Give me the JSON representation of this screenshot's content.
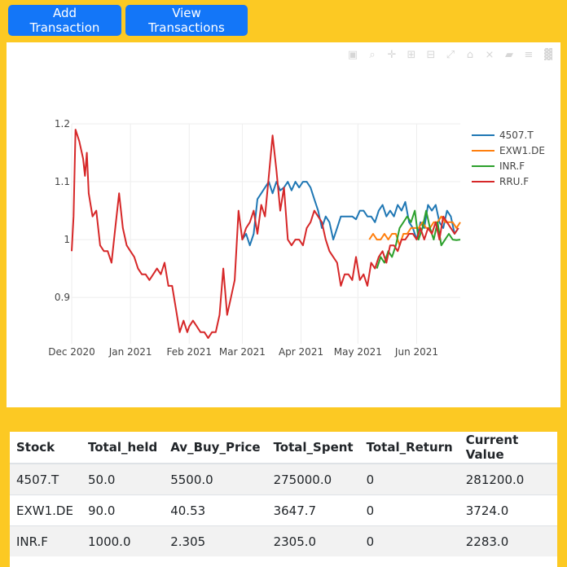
{
  "buttons": {
    "add": "Add Transaction",
    "view": "View Transactions"
  },
  "modebar": [
    "camera-icon",
    "zoom-icon",
    "pan-icon",
    "zoom-in-icon",
    "zoom-out-icon",
    "autoscale-icon",
    "reset-axes-icon",
    "spike-lines-icon",
    "hover-closest-icon",
    "hover-compare-icon",
    "plotly-logo-icon"
  ],
  "chart_data": {
    "type": "line",
    "x_tick_labels": [
      "Dec 2020",
      "Jan 2021",
      "Feb 2021",
      "Mar 2021",
      "Apr 2021",
      "May 2021",
      "Jun 2021"
    ],
    "x_tick_dates": [
      "2020-12-01",
      "2021-01-01",
      "2021-02-01",
      "2021-03-01",
      "2021-04-01",
      "2021-05-01",
      "2021-06-01"
    ],
    "xlim": [
      "2020-12-01",
      "2021-06-24"
    ],
    "y_tick_labels": [
      "0.9",
      "1",
      "1.1",
      "1.2"
    ],
    "y_tick_values": [
      0.9,
      1.0,
      1.1,
      1.2
    ],
    "ylim": [
      0.82,
      1.2
    ],
    "grid": true,
    "legend": "top-right",
    "series": [
      {
        "name": "4507.T",
        "color": "#1f77b4",
        "x": [
          "2021-03-01",
          "2021-03-03",
          "2021-03-05",
          "2021-03-07",
          "2021-03-09",
          "2021-03-11",
          "2021-03-13",
          "2021-03-15",
          "2021-03-17",
          "2021-03-19",
          "2021-03-21",
          "2021-03-23",
          "2021-03-25",
          "2021-03-27",
          "2021-03-29",
          "2021-03-31",
          "2021-04-02",
          "2021-04-04",
          "2021-04-06",
          "2021-04-08",
          "2021-04-10",
          "2021-04-12",
          "2021-04-14",
          "2021-04-16",
          "2021-04-18",
          "2021-04-20",
          "2021-04-22",
          "2021-04-24",
          "2021-04-26",
          "2021-04-28",
          "2021-04-30",
          "2021-05-02",
          "2021-05-04",
          "2021-05-06",
          "2021-05-08",
          "2021-05-10",
          "2021-05-12",
          "2021-05-14",
          "2021-05-16",
          "2021-05-18",
          "2021-05-20",
          "2021-05-22",
          "2021-05-24",
          "2021-05-26",
          "2021-05-28",
          "2021-05-30",
          "2021-06-01",
          "2021-06-03",
          "2021-06-05",
          "2021-06-07",
          "2021-06-09",
          "2021-06-11",
          "2021-06-13",
          "2021-06-15",
          "2021-06-17",
          "2021-06-19",
          "2021-06-21",
          "2021-06-23"
        ],
        "y": [
          1.0,
          1.01,
          0.99,
          1.01,
          1.07,
          1.08,
          1.09,
          1.1,
          1.08,
          1.1,
          1.085,
          1.09,
          1.1,
          1.085,
          1.1,
          1.09,
          1.1,
          1.1,
          1.09,
          1.07,
          1.05,
          1.02,
          1.04,
          1.03,
          1.0,
          1.02,
          1.04,
          1.04,
          1.04,
          1.04,
          1.035,
          1.05,
          1.05,
          1.04,
          1.04,
          1.03,
          1.05,
          1.06,
          1.04,
          1.05,
          1.04,
          1.06,
          1.05,
          1.065,
          1.03,
          1.02,
          1.0,
          1.03,
          1.02,
          1.06,
          1.05,
          1.06,
          1.03,
          1.02,
          1.05,
          1.04,
          1.01,
          1.02
        ]
      },
      {
        "name": "EXW1.DE",
        "color": "#ff7f0e",
        "x": [
          "2021-05-07",
          "2021-05-09",
          "2021-05-11",
          "2021-05-13",
          "2021-05-15",
          "2021-05-17",
          "2021-05-19",
          "2021-05-21",
          "2021-05-23",
          "2021-05-25",
          "2021-05-27",
          "2021-05-29",
          "2021-05-31",
          "2021-06-02",
          "2021-06-04",
          "2021-06-06",
          "2021-06-08",
          "2021-06-10",
          "2021-06-12",
          "2021-06-14",
          "2021-06-16",
          "2021-06-18",
          "2021-06-20",
          "2021-06-22",
          "2021-06-24"
        ],
        "y": [
          1.0,
          1.01,
          1.0,
          1.0,
          1.01,
          1.0,
          1.01,
          1.01,
          0.99,
          1.01,
          1.01,
          1.02,
          1.02,
          1.02,
          1.03,
          1.02,
          1.02,
          1.03,
          1.03,
          1.04,
          1.03,
          1.03,
          1.03,
          1.02,
          1.03
        ]
      },
      {
        "name": "INR.F",
        "color": "#2ca02c",
        "x": [
          "2021-05-11",
          "2021-05-13",
          "2021-05-15",
          "2021-05-17",
          "2021-05-19",
          "2021-05-21",
          "2021-05-23",
          "2021-05-25",
          "2021-05-27",
          "2021-05-29",
          "2021-05-31",
          "2021-06-02",
          "2021-06-04",
          "2021-06-06",
          "2021-06-08",
          "2021-06-10",
          "2021-06-12",
          "2021-06-14",
          "2021-06-16",
          "2021-06-18",
          "2021-06-20",
          "2021-06-22",
          "2021-06-24"
        ],
        "y": [
          0.95,
          0.97,
          0.96,
          0.98,
          0.97,
          0.99,
          1.02,
          1.03,
          1.04,
          1.03,
          1.05,
          1.0,
          1.02,
          1.05,
          1.02,
          1.0,
          1.03,
          0.99,
          1.0,
          1.01,
          1.0,
          0.999,
          1.0
        ]
      },
      {
        "name": "RRU.F",
        "color": "#d62728",
        "x": [
          "2020-12-01",
          "2020-12-02",
          "2020-12-03",
          "2020-12-05",
          "2020-12-07",
          "2020-12-08",
          "2020-12-09",
          "2020-12-10",
          "2020-12-12",
          "2020-12-14",
          "2020-12-16",
          "2020-12-18",
          "2020-12-20",
          "2020-12-22",
          "2020-12-24",
          "2020-12-26",
          "2020-12-28",
          "2020-12-30",
          "2021-01-01",
          "2021-01-03",
          "2021-01-05",
          "2021-01-07",
          "2021-01-09",
          "2021-01-11",
          "2021-01-13",
          "2021-01-15",
          "2021-01-17",
          "2021-01-19",
          "2021-01-21",
          "2021-01-23",
          "2021-01-25",
          "2021-01-27",
          "2021-01-29",
          "2021-01-31",
          "2021-02-01",
          "2021-02-03",
          "2021-02-05",
          "2021-02-07",
          "2021-02-09",
          "2021-02-11",
          "2021-02-13",
          "2021-02-15",
          "2021-02-17",
          "2021-02-19",
          "2021-02-21",
          "2021-02-23",
          "2021-02-25",
          "2021-02-27",
          "2021-03-01",
          "2021-03-03",
          "2021-03-05",
          "2021-03-07",
          "2021-03-09",
          "2021-03-11",
          "2021-03-13",
          "2021-03-15",
          "2021-03-17",
          "2021-03-19",
          "2021-03-21",
          "2021-03-23",
          "2021-03-25",
          "2021-03-27",
          "2021-03-29",
          "2021-03-31",
          "2021-04-02",
          "2021-04-04",
          "2021-04-06",
          "2021-04-08",
          "2021-04-10",
          "2021-04-12",
          "2021-04-14",
          "2021-04-16",
          "2021-04-18",
          "2021-04-20",
          "2021-04-22",
          "2021-04-24",
          "2021-04-26",
          "2021-04-28",
          "2021-04-30",
          "2021-05-02",
          "2021-05-04",
          "2021-05-06",
          "2021-05-08",
          "2021-05-10",
          "2021-05-12",
          "2021-05-14",
          "2021-05-16",
          "2021-05-18",
          "2021-05-20",
          "2021-05-22",
          "2021-05-24",
          "2021-05-26",
          "2021-05-28",
          "2021-05-30",
          "2021-06-01",
          "2021-06-03",
          "2021-06-05",
          "2021-06-07",
          "2021-06-09",
          "2021-06-11",
          "2021-06-13",
          "2021-06-15",
          "2021-06-17",
          "2021-06-19",
          "2021-06-21",
          "2021-06-23"
        ],
        "y": [
          0.98,
          1.04,
          1.19,
          1.17,
          1.14,
          1.11,
          1.15,
          1.08,
          1.04,
          1.05,
          0.99,
          0.98,
          0.98,
          0.96,
          1.02,
          1.08,
          1.02,
          0.99,
          0.98,
          0.97,
          0.95,
          0.94,
          0.94,
          0.93,
          0.94,
          0.95,
          0.94,
          0.96,
          0.92,
          0.92,
          0.88,
          0.84,
          0.86,
          0.84,
          0.85,
          0.86,
          0.85,
          0.84,
          0.84,
          0.83,
          0.84,
          0.84,
          0.87,
          0.95,
          0.87,
          0.9,
          0.93,
          1.05,
          1.0,
          1.02,
          1.03,
          1.05,
          1.01,
          1.06,
          1.04,
          1.11,
          1.18,
          1.12,
          1.05,
          1.09,
          1.0,
          0.99,
          1.0,
          1.0,
          0.99,
          1.02,
          1.03,
          1.05,
          1.04,
          1.03,
          1.0,
          0.98,
          0.97,
          0.96,
          0.92,
          0.94,
          0.94,
          0.93,
          0.97,
          0.93,
          0.94,
          0.92,
          0.96,
          0.95,
          0.97,
          0.98,
          0.96,
          0.99,
          0.99,
          0.98,
          1.0,
          1.0,
          1.01,
          1.01,
          1.0,
          1.02,
          1.0,
          1.02,
          1.01,
          1.03,
          1.0,
          1.04,
          1.03,
          1.02,
          1.01,
          1.02
        ]
      }
    ]
  },
  "table": {
    "headers": [
      "Stock",
      "Total_held",
      "Av_Buy_Price",
      "Total_Spent",
      "Total_Return",
      "Current Value"
    ],
    "rows": [
      [
        "4507.T",
        "50.0",
        "5500.0",
        "275000.0",
        "0",
        "281200.0"
      ],
      [
        "EXW1.DE",
        "90.0",
        "40.53",
        "3647.7",
        "0",
        "3724.0"
      ],
      [
        "INR.F",
        "1000.0",
        "2.305",
        "2305.0",
        "0",
        "2283.0"
      ]
    ]
  }
}
